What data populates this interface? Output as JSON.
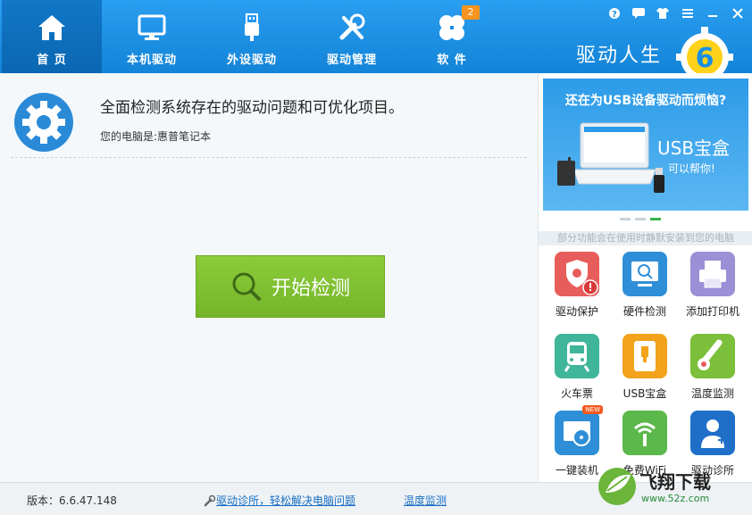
{
  "nav": {
    "items": [
      {
        "label": "首 页",
        "icon": "home-icon"
      },
      {
        "label": "本机驱动",
        "icon": "monitor-icon"
      },
      {
        "label": "外设驱动",
        "icon": "usb-icon"
      },
      {
        "label": "驱动管理",
        "icon": "tools-icon"
      },
      {
        "label": "软 件",
        "icon": "clover-icon"
      }
    ],
    "software_badge": "2"
  },
  "brand": {
    "name": "驱动人生",
    "logo_digit": "6"
  },
  "main": {
    "title": "全面检测系统存在的驱动问题和可优化项目。",
    "subtitle": "您的电脑是:惠普笔记本",
    "scan_button": "开始检测"
  },
  "banner": {
    "title": "还在为USB设备驱动而烦恼?",
    "product": "USB宝盒",
    "tagline": "可以帮你!"
  },
  "notice": "部分功能会在使用时静默安装到您的电脑",
  "tools": [
    {
      "label": "驱动保护",
      "icon": "shield-gear-icon",
      "color": "#e75d5b"
    },
    {
      "label": "硬件检测",
      "icon": "monitor-check-icon",
      "color": "#2e8fd8"
    },
    {
      "label": "添加打印机",
      "icon": "printer-icon",
      "color": "#9b8fd6"
    },
    {
      "label": "火车票",
      "icon": "train-icon",
      "color": "#3fb59a"
    },
    {
      "label": "USB宝盒",
      "icon": "usb-box-icon",
      "color": "#f2a21b"
    },
    {
      "label": "温度监测",
      "icon": "thermometer-icon",
      "color": "#7cbf3a"
    },
    {
      "label": "一键装机",
      "icon": "disc-install-icon",
      "color": "#2e8fd8"
    },
    {
      "label": "免费WiFi",
      "icon": "wifi-icon",
      "color": "#5bb84a"
    },
    {
      "label": "驱动诊所",
      "icon": "doctor-icon",
      "color": "#1f6fc9"
    }
  ],
  "new_tag": "NEW",
  "footer": {
    "version": "版本：6.6.47.148",
    "diagnosis_link": "驱动诊所，轻松解决电脑问题",
    "temp_link": "温度监测"
  },
  "watermark": {
    "text": "飞翔下载",
    "url": "www.52z.com"
  },
  "colors": {
    "header": "#1a8fe0",
    "active_tab": "#0d6fbd",
    "scan_button": "#7fc232"
  }
}
